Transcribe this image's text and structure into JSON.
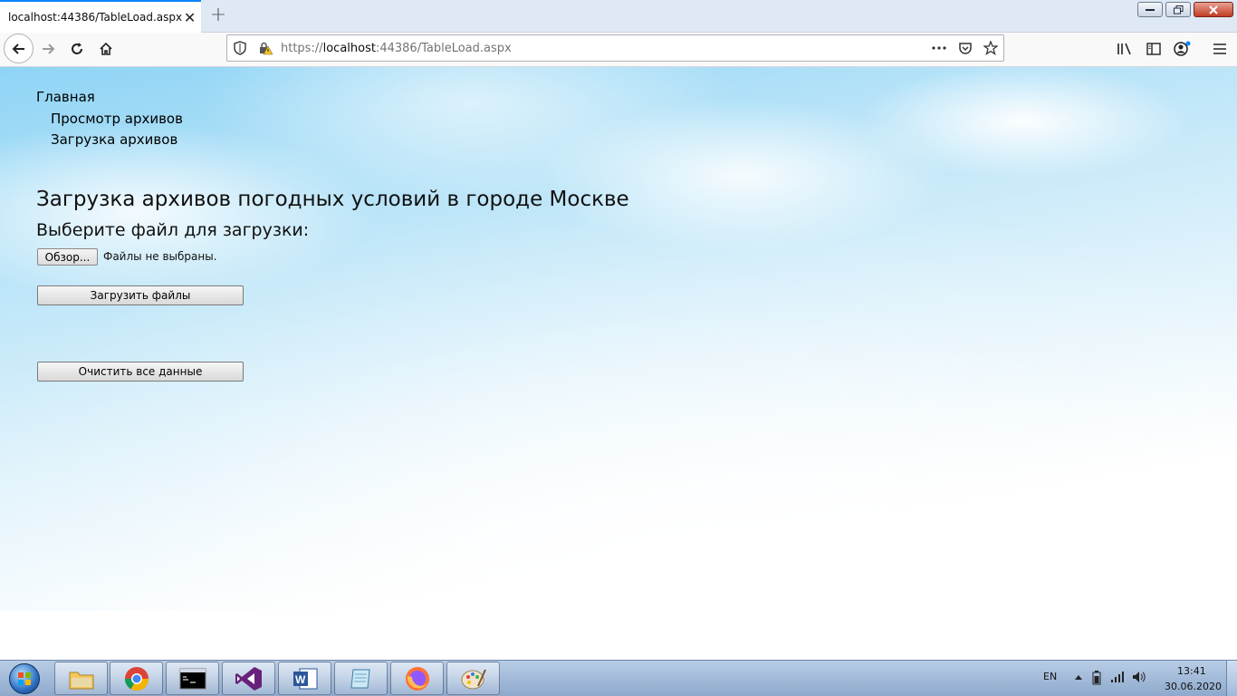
{
  "browser": {
    "tab_title": "localhost:44386/TableLoad.aspx",
    "tab_close": "✕",
    "new_tab": "+",
    "url_scheme": "https://",
    "url_host": "localhost",
    "url_rest": ":44386/TableLoad.aspx"
  },
  "menu": {
    "root": "Главная",
    "items": [
      {
        "label": "Просмотр архивов"
      },
      {
        "label": "Загрузка архивов"
      }
    ]
  },
  "page": {
    "title": "Загрузка архивов погодных условий в городе Москве",
    "subtitle": "Выберите файл для загрузки:",
    "browse_label": "Обзор...",
    "no_file_text": "Файлы не выбраны.",
    "upload_label": "Загрузить файлы",
    "clear_label": "Очистить все данные"
  },
  "taskbar": {
    "apps": [
      {
        "name": "explorer"
      },
      {
        "name": "chrome"
      },
      {
        "name": "cmd"
      },
      {
        "name": "visual-studio"
      },
      {
        "name": "word"
      },
      {
        "name": "notepad"
      },
      {
        "name": "firefox"
      },
      {
        "name": "paint"
      }
    ],
    "language": "EN",
    "time": "13:41",
    "date": "30.06.2020"
  }
}
